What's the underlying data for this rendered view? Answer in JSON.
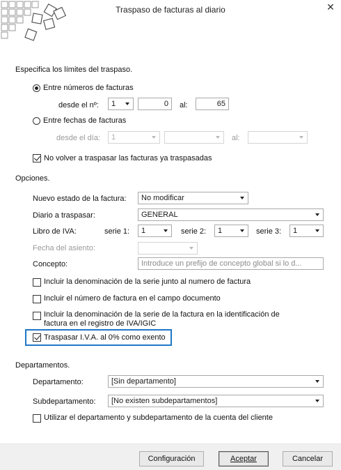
{
  "window": {
    "title": "Traspaso de facturas al diario",
    "close_glyph": "✕"
  },
  "limits": {
    "heading": "Especifica los límites del traspaso.",
    "by_numbers": {
      "label": "Entre números de facturas",
      "selected": true,
      "from_label": "desde el nº:",
      "series_value": "1",
      "from_value": "0",
      "to_label": "al:",
      "to_value": "65"
    },
    "by_dates": {
      "label": "Entre fechas de facturas",
      "selected": false,
      "from_label": "desde el día:",
      "series_value": "1",
      "from_date": "",
      "to_label": "al:",
      "to_date": ""
    },
    "skip_transferred": {
      "label": "No volver a traspasar las facturas ya traspasadas",
      "checked": true
    }
  },
  "options": {
    "heading": "Opciones.",
    "new_state": {
      "label": "Nuevo estado de la factura:",
      "value": "No modificar"
    },
    "journal": {
      "label": "Diario a traspasar:",
      "value": "GENERAL"
    },
    "vat_book": {
      "label": "Libro de IVA:",
      "serie1_label": "serie 1:",
      "serie1_value": "1",
      "serie2_label": "serie 2:",
      "serie2_value": "1",
      "serie3_label": "serie 3:",
      "serie3_value": "1"
    },
    "entry_date": {
      "label": "Fecha del asiento:",
      "value": ""
    },
    "concept": {
      "label": "Concepto:",
      "placeholder": "Introduce un prefijo de concepto global si lo d..."
    },
    "include_series_name": {
      "label": "Incluir la denominación de la serie junto al numero de factura",
      "checked": false
    },
    "include_invoice_number": {
      "label": "Incluir el número de factura en el campo documento",
      "checked": false
    },
    "include_series_in_register": {
      "label_line1": "Incluir la denominación de la serie de la factura en la identificación de",
      "label_line2": "factura en el registro de IVA/IGIC",
      "checked": false
    },
    "transfer_zero_vat": {
      "label": "Traspasar I.V.A. al 0% como exento",
      "checked": true
    }
  },
  "departments": {
    "heading": "Departamentos.",
    "department": {
      "label": "Departamento:",
      "value": "[Sin departamento]"
    },
    "subdepartment": {
      "label": "Subdepartamento:",
      "value": "[No existen subdepartamentos]"
    },
    "use_client_dept": {
      "label": "Utilizar el departamento y subdepartamento de la cuenta del cliente",
      "checked": false
    }
  },
  "footer": {
    "config_label": "Configuración",
    "accept_label": "Aceptar",
    "cancel_label": "Cancelar"
  },
  "colors": {
    "focus_border": "#1e77c8",
    "footer_bg": "#f0f0f0"
  }
}
